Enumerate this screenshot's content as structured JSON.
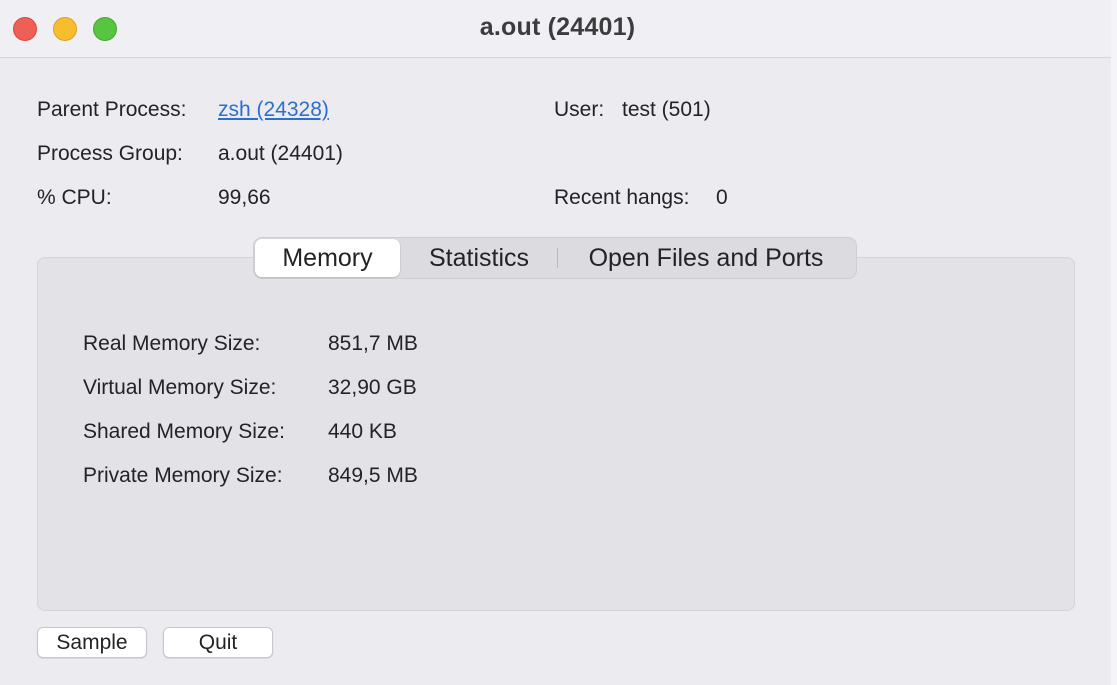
{
  "window": {
    "title": "a.out (24401)"
  },
  "info": {
    "parent_process_label": "Parent Process:",
    "parent_process_value": "zsh (24328)",
    "process_group_label": "Process Group:",
    "process_group_value": "a.out (24401)",
    "cpu_label": "% CPU:",
    "cpu_value": "99,66",
    "user_label": "User:",
    "user_value": "test (501)",
    "recent_hangs_label": "Recent hangs:",
    "recent_hangs_value": "0"
  },
  "tabs": [
    {
      "label": "Memory",
      "selected": true
    },
    {
      "label": "Statistics",
      "selected": false
    },
    {
      "label": "Open Files and Ports",
      "selected": false
    }
  ],
  "memory": {
    "rows": [
      {
        "label": "Real Memory Size:",
        "value": "851,7 MB"
      },
      {
        "label": "Virtual Memory Size:",
        "value": "32,90 GB"
      },
      {
        "label": "Shared Memory Size:",
        "value": "440 KB"
      },
      {
        "label": "Private Memory Size:",
        "value": "849,5 MB"
      }
    ]
  },
  "buttons": {
    "sample_label": "Sample",
    "quit_label": "Quit"
  },
  "colors": {
    "link": "#2c6fd1",
    "close": "#ee5f58",
    "minimize": "#f7bd2f",
    "zoom": "#59c43f"
  }
}
